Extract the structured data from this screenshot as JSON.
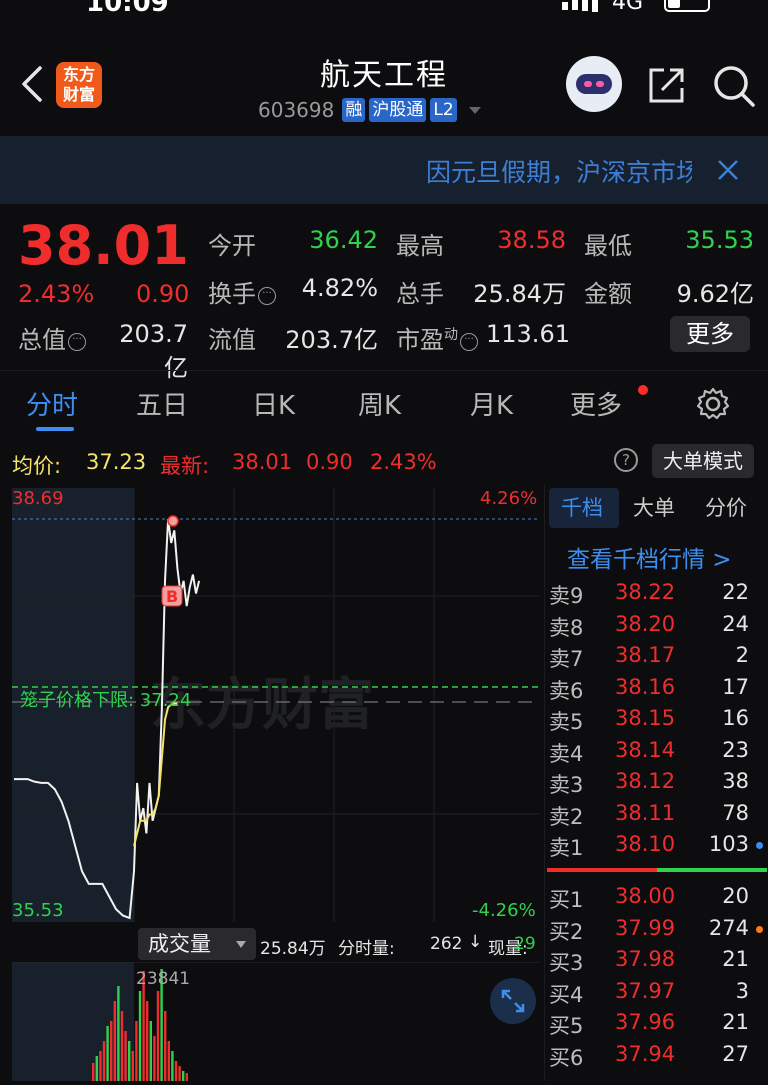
{
  "status_bar": {
    "time": "10:09",
    "network": "4G"
  },
  "header": {
    "title": "航天工程",
    "code": "603698",
    "tags": [
      "融",
      "沪股通",
      "L2"
    ],
    "logo_text": [
      "东方",
      "财富"
    ]
  },
  "notice": {
    "text": "因元旦假期，沪深京市场"
  },
  "quote": {
    "price": "38.01",
    "change_pct": "2.43%",
    "change": "0.90",
    "open_label": "今开",
    "open": "36.42",
    "high_label": "最高",
    "high": "38.58",
    "low_label": "最低",
    "low": "35.53",
    "turnover_label": "换手",
    "turnover": "4.82%",
    "volume_label": "总手",
    "volume": "25.84万",
    "amount_label": "金额",
    "amount": "9.62亿",
    "mktcap_label": "总值",
    "mktcap": "203.7亿",
    "float_label": "流值",
    "float_cap": "203.7亿",
    "pe_label": "市盈",
    "pe_sup": "动",
    "pe": "113.61",
    "more_label": "更多",
    "dots_glyph": "···"
  },
  "tabs": [
    "分时",
    "五日",
    "日K",
    "周K",
    "月K",
    "更多"
  ],
  "avg_row": {
    "avg_label": "均价:",
    "avg": "37.23",
    "latest_label": "最新:",
    "latest": "38.01",
    "latest_chg": "0.90",
    "latest_pct": "2.43%",
    "help": "?",
    "mode_label": "大单模式"
  },
  "chart": {
    "top_price": "38.69",
    "top_pct": "4.26%",
    "bottom_price": "35.53",
    "bottom_pct": "-4.26%",
    "limit_label": "笼子价格下限: 37.24",
    "b_marker": "B",
    "watermark": "东方财富",
    "price_line": [
      36.63,
      36.63,
      36.63,
      36.61,
      36.6,
      36.6,
      36.55,
      36.45,
      36.3,
      36.1,
      35.9,
      35.8,
      35.8,
      35.8,
      35.7,
      35.6,
      35.55,
      35.53,
      35.9,
      36.6,
      36.3,
      36.4,
      36.2,
      36.6,
      36.3,
      36.4,
      36.5,
      37.2,
      38.2,
      38.69,
      38.5,
      38.6,
      38.3,
      38.1,
      38.2,
      38.0,
      38.15,
      38.25,
      38.1,
      38.2
    ],
    "avg_line": [
      null,
      null,
      null,
      null,
      null,
      null,
      null,
      null,
      null,
      null,
      null,
      null,
      null,
      null,
      null,
      null,
      null,
      null,
      36.1,
      36.2,
      36.3,
      36.3,
      36.3,
      36.35,
      36.35,
      36.4,
      36.5,
      36.8,
      37.1,
      37.2,
      37.22,
      37.23,
      37.23
    ]
  },
  "volume": {
    "dropdown_label": "成交量",
    "total": "25.84万",
    "min_label": "分时量:",
    "min_vol": "262",
    "arrow": "↓",
    "now_label": "现量:",
    "now_vol": "29",
    "peak_label": "23841"
  },
  "order_book": {
    "tabs": [
      "千档",
      "大单",
      "分价"
    ],
    "view_link": "查看千档行情 >",
    "asks": [
      {
        "k": "卖9",
        "p": "38.22",
        "v": "22"
      },
      {
        "k": "卖8",
        "p": "38.20",
        "v": "24"
      },
      {
        "k": "卖7",
        "p": "38.17",
        "v": "2"
      },
      {
        "k": "卖6",
        "p": "38.16",
        "v": "17"
      },
      {
        "k": "卖5",
        "p": "38.15",
        "v": "16"
      },
      {
        "k": "卖4",
        "p": "38.14",
        "v": "23"
      },
      {
        "k": "卖3",
        "p": "38.12",
        "v": "38"
      },
      {
        "k": "卖2",
        "p": "38.11",
        "v": "78"
      },
      {
        "k": "卖1",
        "p": "38.10",
        "v": "103"
      }
    ],
    "bids": [
      {
        "k": "买1",
        "p": "38.00",
        "v": "20"
      },
      {
        "k": "买2",
        "p": "37.99",
        "v": "274"
      },
      {
        "k": "买3",
        "p": "37.98",
        "v": "21"
      },
      {
        "k": "买4",
        "p": "37.97",
        "v": "3"
      },
      {
        "k": "买5",
        "p": "37.96",
        "v": "21"
      },
      {
        "k": "买6",
        "p": "37.94",
        "v": "27"
      }
    ]
  },
  "colors": {
    "up": "#ef2d2d",
    "down": "#2fd24d",
    "accent": "#3d8ef0",
    "avg": "#f5e36b"
  }
}
